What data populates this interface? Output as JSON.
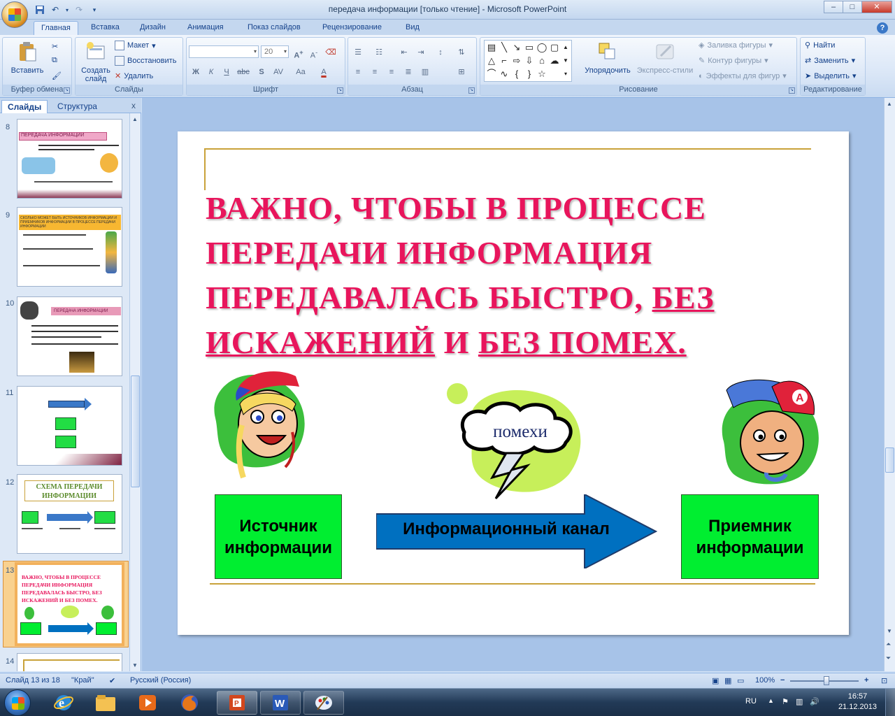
{
  "window": {
    "title": "передача информации  [только чтение] - Microsoft PowerPoint",
    "controls": [
      "–",
      "□",
      "✕"
    ]
  },
  "ribbon_tabs": [
    "Главная",
    "Вставка",
    "Дизайн",
    "Анимация",
    "Показ слайдов",
    "Рецензирование",
    "Вид"
  ],
  "ribbon": {
    "clipboard": {
      "label": "Буфер обмена",
      "paste": "Вставить"
    },
    "slides": {
      "label": "Слайды",
      "new_slide": "Создать слайд",
      "layout": "Макет",
      "reset": "Восстановить",
      "delete": "Удалить"
    },
    "font": {
      "label": "Шрифт",
      "size": "20",
      "bold": "Ж",
      "italic": "К",
      "underline": "Ч",
      "strike": "abc",
      "shadow": "S",
      "spacing": "AV",
      "case": "Aa",
      "color": "A"
    },
    "paragraph": {
      "label": "Абзац"
    },
    "drawing": {
      "label": "Рисование",
      "arrange": "Упорядочить",
      "quick_styles": "Экспресс-стили",
      "fill": "Заливка фигуры",
      "outline": "Контур фигуры",
      "effects": "Эффекты для фигур"
    },
    "editing": {
      "label": "Редактирование",
      "find": "Найти",
      "replace": "Заменить",
      "select": "Выделить"
    }
  },
  "left_pane": {
    "tabs": [
      "Слайды",
      "Структура"
    ],
    "close": "x",
    "thumbnails": [
      {
        "num": "8",
        "title": "ПЕРЕДАЧА ИНФОРМАЦИИ"
      },
      {
        "num": "9",
        "title": "СКОЛЬКО МОЖЕТ БЫТЬ ИСТОЧНИКОВ ИНФОРМАЦИИ И ПРИЕМНИКОВ ИНФОРМАЦИИ В ПРОЦЕССЕ ПЕРЕДАЧИ ИНФОРМАЦИИ"
      },
      {
        "num": "10",
        "title": "ПЕРЕДАЧА ИНФОРМАЦИИ"
      },
      {
        "num": "11",
        "title": ""
      },
      {
        "num": "12",
        "title": "СХЕМА ПЕРЕДАЧИ ИНФОРМАЦИИ"
      },
      {
        "num": "13",
        "title": "ВАЖНО, ЧТОБЫ В ПРОЦЕССЕ ПЕРЕДАЧИ ИНФОРМАЦИЯ ПЕРЕДАВАЛАСЬ БЫСТРО, БЕЗ ИСКАЖЕНИЙ И БЕЗ ПОМЕХ."
      },
      {
        "num": "14",
        "title": ""
      }
    ],
    "selected_index": 5
  },
  "slide": {
    "title_part1": "ВАЖНО, ЧТОБЫ В ПРОЦЕССЕ ПЕРЕДАЧИ ИНФОРМАЦИЯ ПЕРЕДАВАЛАСЬ  БЫСТРО, ",
    "title_u1": "БЕЗ ИСКАЖЕНИЙ",
    "title_mid": " И ",
    "title_u2": "БЕЗ ПОМЕХ.",
    "source_line1": "Источник",
    "source_line2": "информации",
    "channel": "Информационный канал",
    "receiver_line1": "Приемник",
    "receiver_line2": "информации",
    "noise": "помехи",
    "colors": {
      "title": "#e8155c",
      "box": "#00ee30",
      "arrow": "#0070c0",
      "gold": "#c9a23a"
    }
  },
  "status_bar": {
    "slide_info": "Слайд 13 из 18",
    "theme": "\"Край\"",
    "language": "Русский (Россия)",
    "zoom": "100%"
  },
  "taskbar": {
    "lang": "RU",
    "time": "16:57",
    "date": "21.12.2013"
  }
}
